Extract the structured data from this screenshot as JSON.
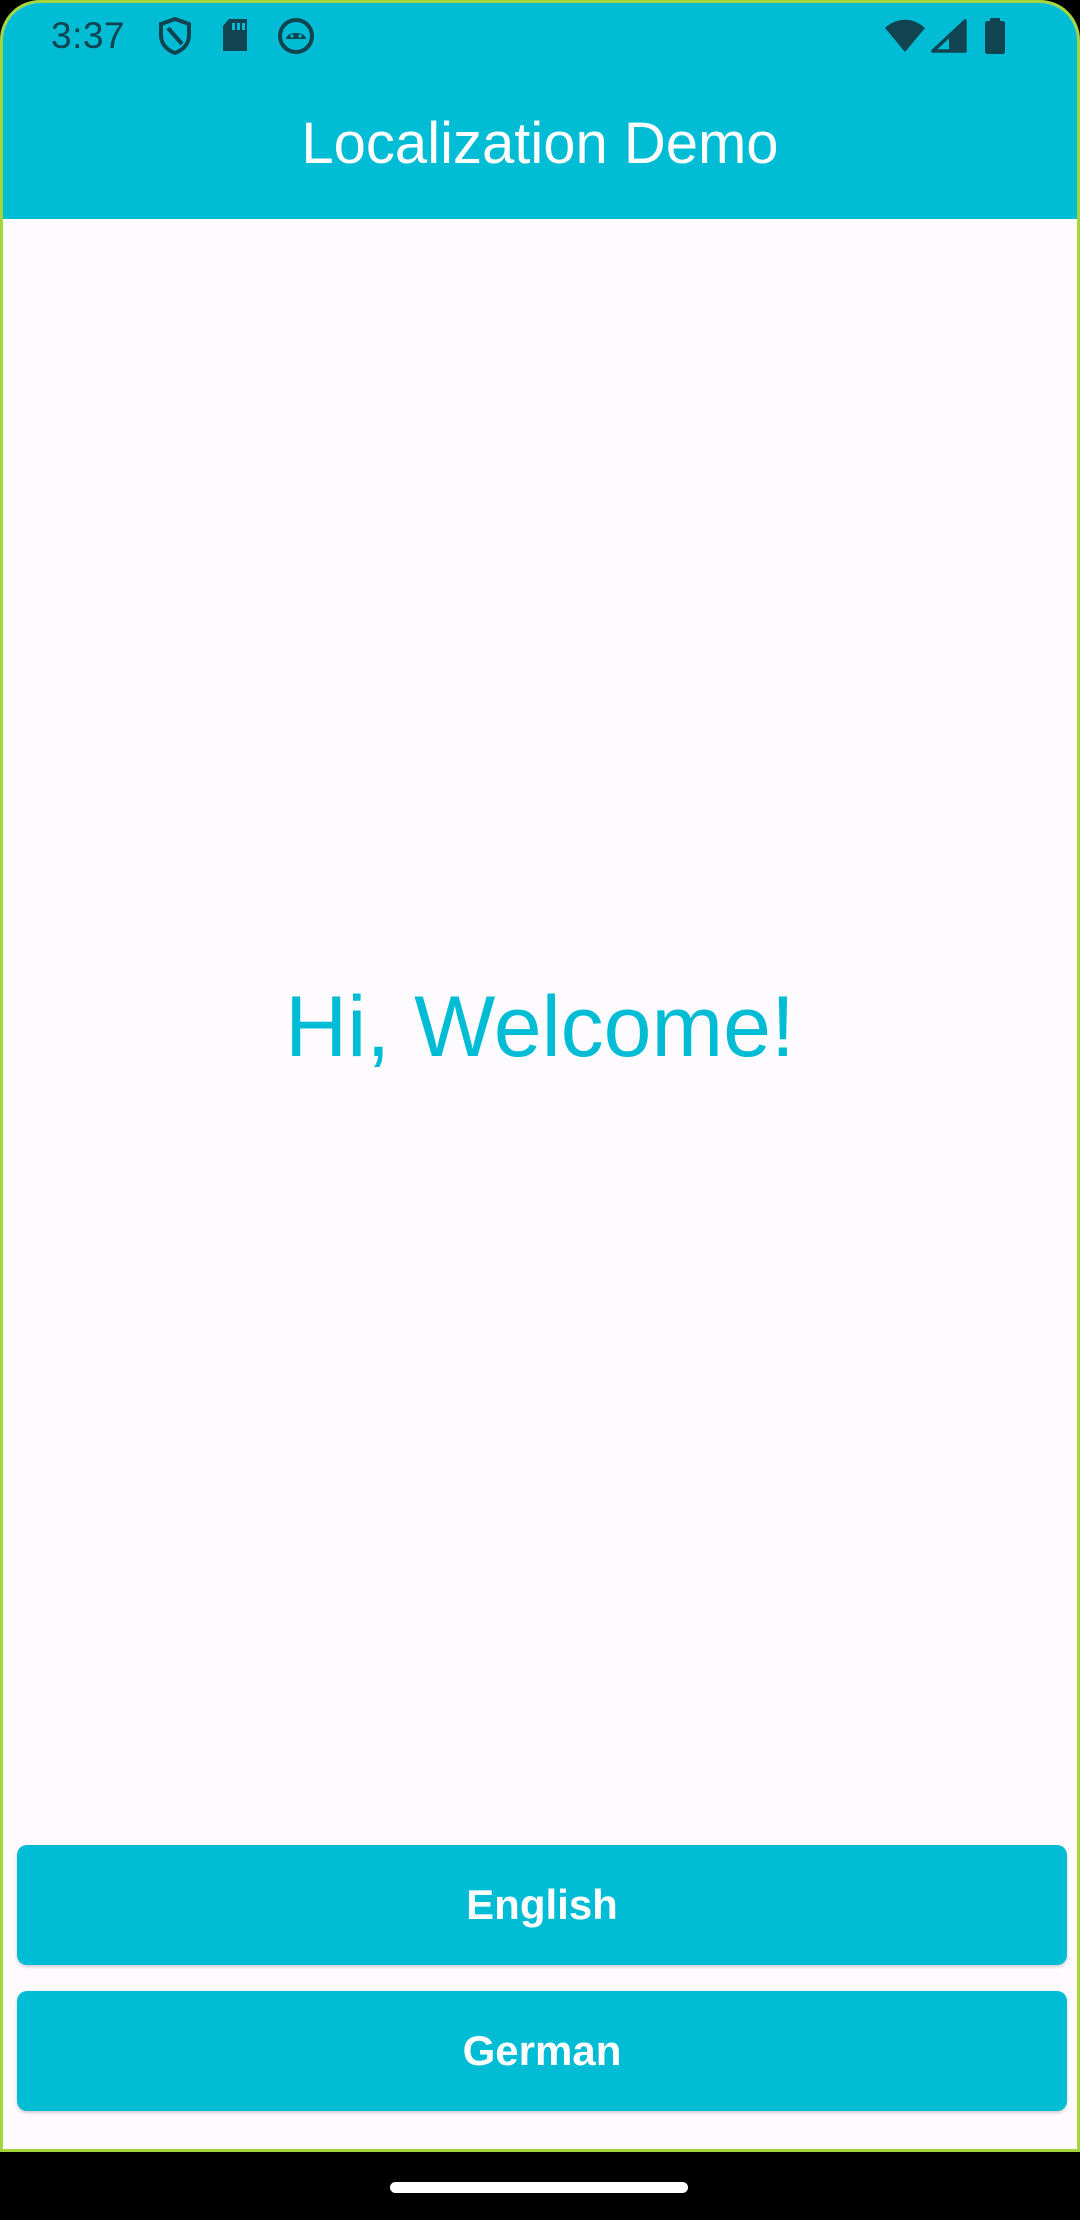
{
  "status_bar": {
    "time": "3:37",
    "left_icons": [
      "shield-icon",
      "sd-card-icon",
      "android-face-icon"
    ],
    "right_icons": [
      "wifi-icon",
      "cell-signal-icon",
      "battery-icon"
    ]
  },
  "app_bar": {
    "title": "Localization Demo"
  },
  "main": {
    "greeting": "Hi, Welcome!"
  },
  "buttons": {
    "english_label": "English",
    "german_label": "German"
  },
  "colors": {
    "primary": "#00bcd4",
    "status_icon": "#0f4450",
    "background": "#fefbfe"
  }
}
